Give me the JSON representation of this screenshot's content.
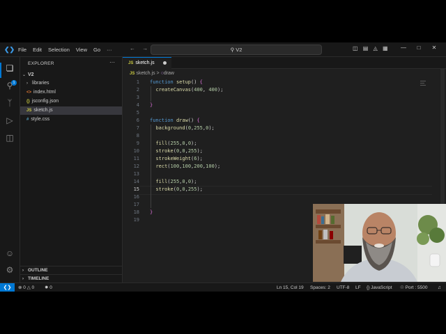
{
  "menu": [
    "File",
    "Edit",
    "Selection",
    "View",
    "Go"
  ],
  "menu_more": "···",
  "command_center": {
    "label": "V2",
    "icon": "search-icon"
  },
  "sidebar": {
    "header": "EXPLORER",
    "more": "···",
    "folder": "V2",
    "items": [
      {
        "label": "libraries",
        "type": "folder"
      },
      {
        "label": "index.html",
        "type": "html"
      },
      {
        "label": "jsconfig.json",
        "type": "json"
      },
      {
        "label": "sketch.js",
        "type": "js",
        "selected": true
      },
      {
        "label": "style.css",
        "type": "css"
      }
    ],
    "outline": "OUTLINE",
    "timeline": "TIMELINE"
  },
  "activity_badge": "1",
  "tab": {
    "icon": "JS",
    "label": "sketch.js",
    "dirty": true
  },
  "breadcrumb": {
    "file": "sketch.js",
    "separator": ">",
    "symbol": "draw"
  },
  "code_lines": [
    "function setup() {",
    "  createCanvas(400, 400);",
    "",
    "}",
    "",
    "function draw() {",
    "  background(0,255,0);",
    "",
    "  fill(255,0,0);",
    "  stroke(0,0,255);",
    "  strokeWeight(6);",
    "  rect(100,100,200,100);",
    "",
    "  fill(255,0,0);",
    "  stroke(0,0,255);",
    "",
    "",
    "}",
    ""
  ],
  "line_numbers": [
    "1",
    "2",
    "3",
    "4",
    "5",
    "6",
    "7",
    "8",
    "9",
    "10",
    "11",
    "12",
    "13",
    "14",
    "15",
    "16",
    "17",
    "18",
    "19"
  ],
  "current_line": 15,
  "status": {
    "errors": "0",
    "warnings": "0",
    "ports": "0",
    "position": "Ln 15, Col 19",
    "spaces": "Spaces: 2",
    "encoding": "UTF-8",
    "eol": "LF",
    "language": "JavaScript",
    "port": "Port : 5500"
  },
  "colors": {
    "accent": "#0078d4",
    "editor_bg": "#1f1f1f",
    "keyword": "#569cd6",
    "function": "#dcdcaa",
    "number": "#b5cea8"
  }
}
